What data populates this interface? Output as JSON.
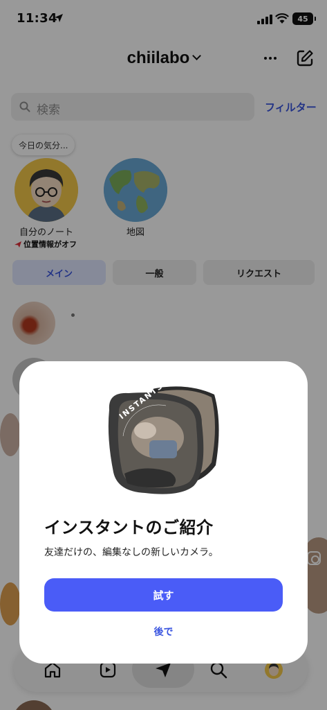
{
  "status_bar": {
    "time": "11:34",
    "battery": "45"
  },
  "header": {
    "account_name": "chiilabo"
  },
  "search": {
    "placeholder": "検索",
    "filter_label": "フィルター"
  },
  "notes": {
    "mood_prompt": "今日の気分...",
    "my_note_label": "自分のノート",
    "location_status": "位置情報がオフ",
    "map_label": "地図"
  },
  "tabs": [
    {
      "label": "メイン",
      "active": true
    },
    {
      "label": "一般",
      "active": false
    },
    {
      "label": "リクエスト",
      "active": false
    }
  ],
  "modal": {
    "badge_text": "INSTANTS",
    "title": "インスタントのご紹介",
    "description": "友達だけの、編集なしの新しいカメラ。",
    "primary_button": "試す",
    "secondary_link": "後で"
  },
  "colors": {
    "accent": "#4a5cf7",
    "link": "#3a55e0",
    "overlay": "rgba(0,0,0,0.40)"
  },
  "icons": [
    "location-arrow-icon",
    "signal-icon",
    "wifi-icon",
    "battery-icon",
    "chevron-down-icon",
    "more-icon",
    "compose-icon",
    "search-icon",
    "airplane-icon",
    "home-icon",
    "reels-icon",
    "send-icon",
    "search-nav-icon",
    "profile-avatar",
    "instagram-icon"
  ]
}
